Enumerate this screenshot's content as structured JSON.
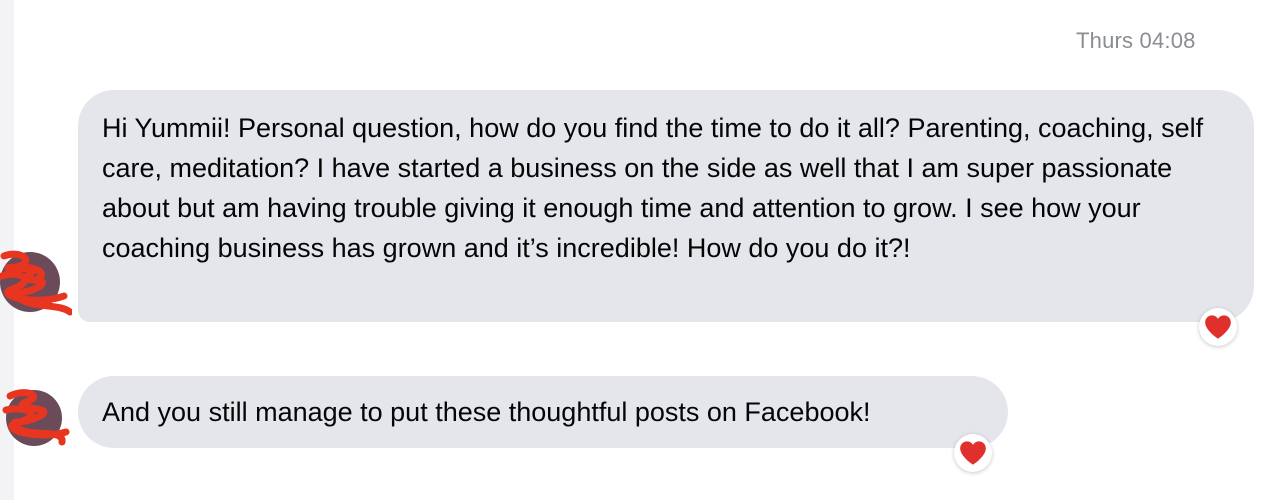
{
  "thread": {
    "timestamp": "Thurs 04:08",
    "messages": [
      {
        "text": "Hi Yummii! Personal question, how do you find the time to do it all? Parenting, coaching, self care, meditation? I have started a business on the side as well that I am super passionate about but am having trouble giving it enough time and attention to grow. I see how your coaching business has grown and it’s incredible! How do you do it?!",
        "reaction_icon": "heart-icon"
      },
      {
        "text": "And you still manage to put these thoughtful posts on Facebook!",
        "reaction_icon": "heart-icon"
      }
    ]
  },
  "colors": {
    "bubble": "#e4e6eb",
    "timestamp": "#8a8d91",
    "heart": "#e0302e",
    "avatar_scribble": "#e8351f"
  }
}
